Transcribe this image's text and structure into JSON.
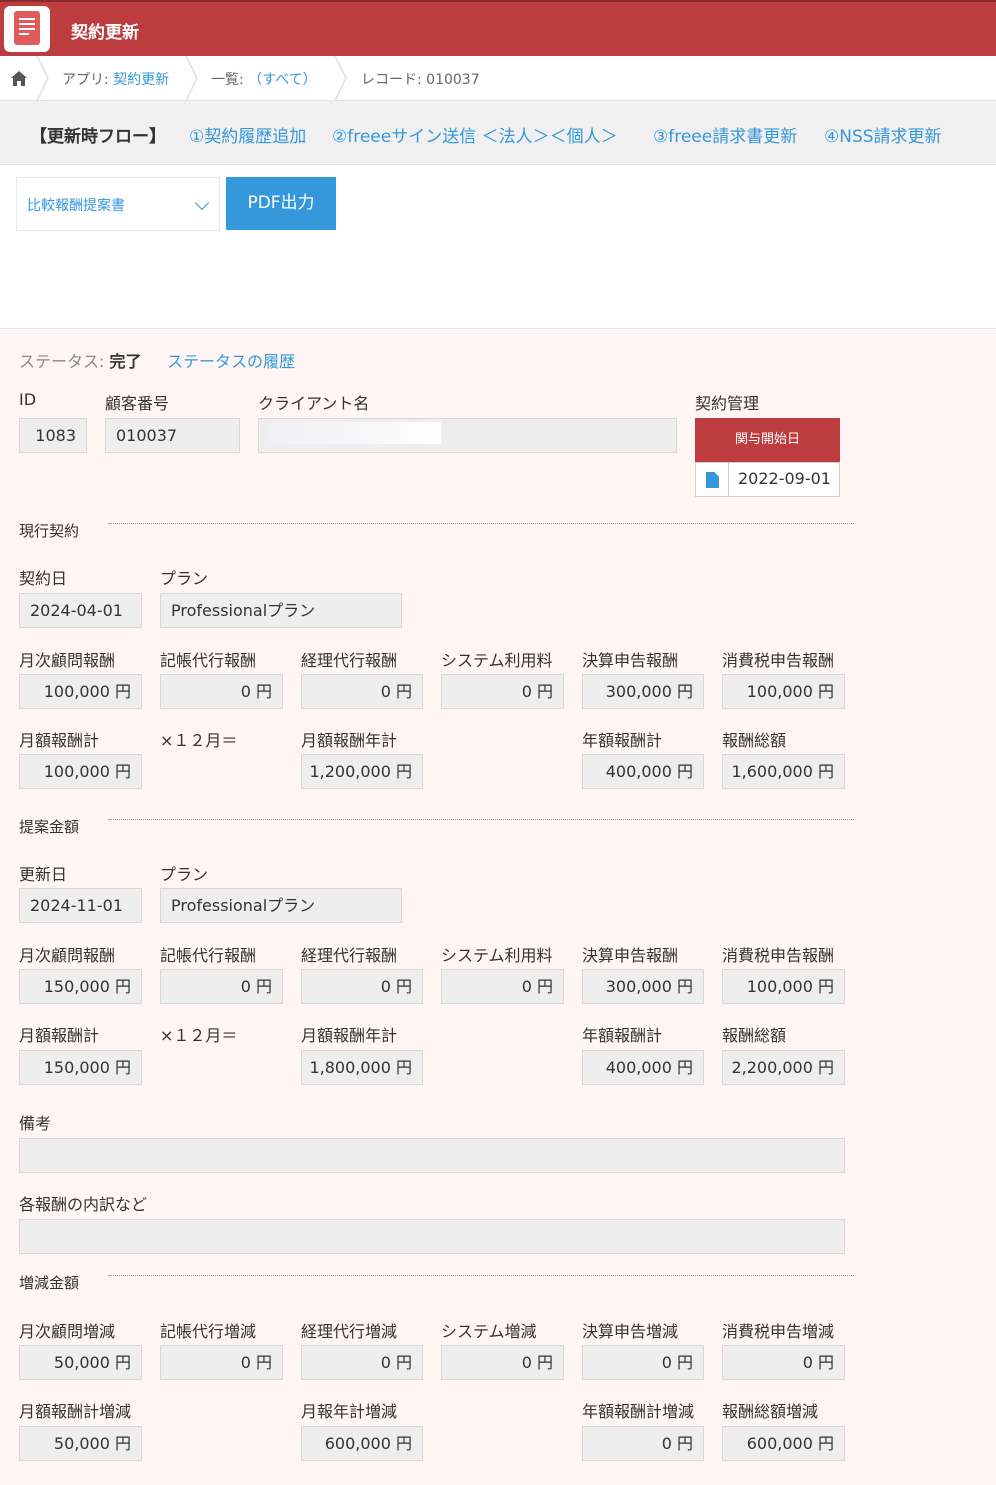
{
  "app": {
    "title": "契約更新"
  },
  "breadcrumb": {
    "app_prefix": "アプリ: ",
    "app_name": "契約更新",
    "list_prefix": "一覧: ",
    "list_name": "（すべて）",
    "record": "レコード: 010037"
  },
  "flow": {
    "title": "【更新時フロー】",
    "links": [
      "①契約履歴追加",
      "②freeeサイン送信 ＜法人＞＜個人＞",
      "③freee請求書更新",
      "④NSS請求更新"
    ]
  },
  "toolbar": {
    "select_value": "比較報酬提案書",
    "pdf_label": "PDF出力"
  },
  "status": {
    "label": "ステータス: ",
    "value": "完了",
    "history_link": "ステータスの履歴"
  },
  "header": {
    "id_label": "ID",
    "id_value": "1083",
    "customer_label": "顧客番号",
    "customer_value": "010037",
    "client_label": "クライアント名",
    "client_value": "",
    "mgmt_label": "契約管理",
    "mgmt_col": "関与開始日",
    "mgmt_value": "2022-09-01"
  },
  "current": {
    "group": "現行契約",
    "date_label": "契約日",
    "date": "2024-04-01",
    "plan_label": "プラン",
    "plan": "Professionalプラン",
    "fee_labels": [
      "月次顧問報酬",
      "記帳代行報酬",
      "経理代行報酬",
      "システム利用料",
      "決算申告報酬",
      "消費税申告報酬"
    ],
    "fees": [
      "100,000 円",
      "0 円",
      "0 円",
      "0 円",
      "300,000 円",
      "100,000 円"
    ],
    "monthly_label": "月額報酬計",
    "monthly": "100,000 円",
    "mult": "×１２月＝",
    "annual_label": "月額報酬年計",
    "annual": "1,200,000 円",
    "yearly_label": "年額報酬計",
    "yearly": "400,000 円",
    "total_label": "報酬総額",
    "total": "1,600,000 円"
  },
  "proposal": {
    "group": "提案金額",
    "date_label": "更新日",
    "date": "2024-11-01",
    "plan_label": "プラン",
    "plan": "Professionalプラン",
    "fee_labels": [
      "月次顧問報酬",
      "記帳代行報酬",
      "経理代行報酬",
      "システム利用料",
      "決算申告報酬",
      "消費税申告報酬"
    ],
    "fees": [
      "150,000 円",
      "0 円",
      "0 円",
      "0 円",
      "300,000 円",
      "100,000 円"
    ],
    "monthly_label": "月額報酬計",
    "monthly": "150,000 円",
    "mult": "×１２月＝",
    "annual_label": "月額報酬年計",
    "annual": "1,800,000 円",
    "yearly_label": "年額報酬計",
    "yearly": "400,000 円",
    "total_label": "報酬総額",
    "total": "2,200,000 円"
  },
  "notes": {
    "memo_label": "備考",
    "memo": "",
    "breakdown_label": "各報酬の内訳など",
    "breakdown": ""
  },
  "diff": {
    "group": "増減金額",
    "labels": [
      "月次顧問増減",
      "記帳代行増減",
      "経理代行増減",
      "システム増減",
      "決算申告増減",
      "消費税申告増減"
    ],
    "values": [
      "50,000 円",
      "0 円",
      "0 円",
      "0 円",
      "0 円",
      "0 円"
    ],
    "monthly_label": "月額報酬計増減",
    "monthly": "50,000 円",
    "annual_label": "月報年計増減",
    "annual": "600,000 円",
    "yearly_label": "年額報酬計増減",
    "yearly": "0 円",
    "total_label": "報酬総額増減",
    "total": "600,000 円"
  }
}
